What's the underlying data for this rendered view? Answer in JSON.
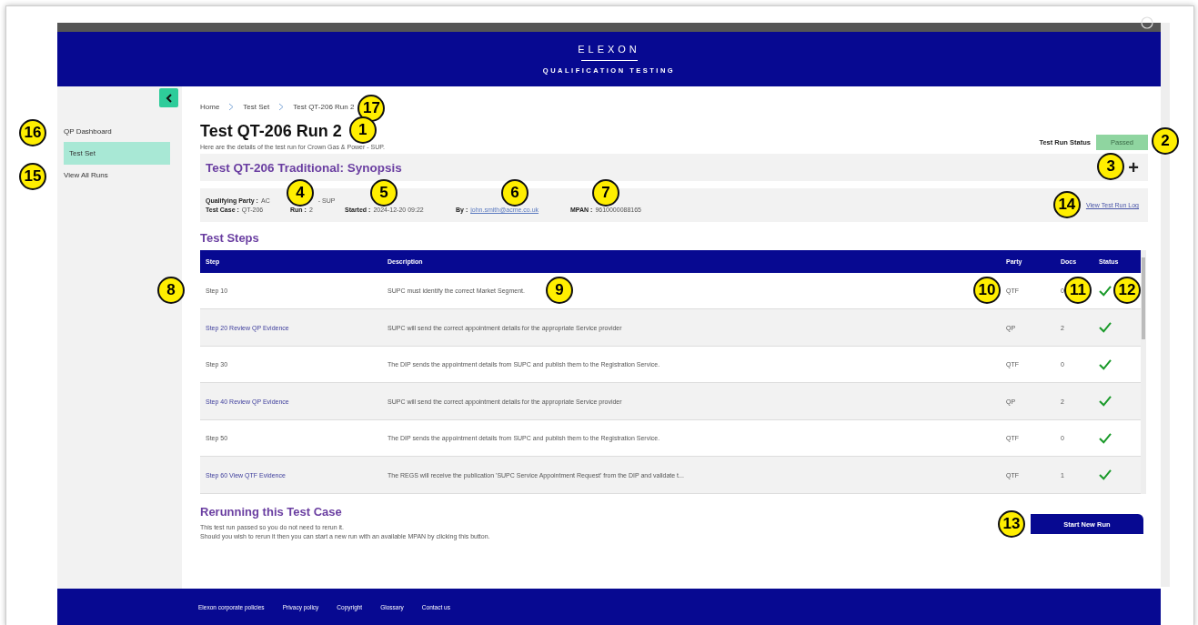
{
  "header": {
    "logo": "ELEXON",
    "subtitle": "QUALIFICATION TESTING"
  },
  "sidebar": {
    "items": [
      {
        "label": "QP Dashboard",
        "selected": false,
        "callout": "16"
      },
      {
        "label": "Test Set",
        "selected": true
      },
      {
        "label": "View All Runs",
        "selected": false,
        "callout": "15"
      }
    ]
  },
  "breadcrumb": {
    "items": [
      "Home",
      "Test Set",
      "Test QT-206 Run 2"
    ],
    "callout": "17"
  },
  "page": {
    "title": "Test QT-206 Run 2",
    "title_callout": "1",
    "description": "Here are the details of the test run for Crown Gas & Power - SUP.",
    "status_label": "Test Run Status",
    "status": "Passed",
    "status_callout": "2"
  },
  "synopsis": {
    "title": "Test QT-206 Traditional: Synopsis",
    "expand": "+",
    "callout": "3"
  },
  "details": {
    "qualifying_party": {
      "label": "Qualifying Party :",
      "value_start": "AC",
      "value_end": "- SUP"
    },
    "fields": [
      {
        "label": "Test Case :",
        "value": "QT-206",
        "kind": "text"
      },
      {
        "label": "Run :",
        "value": "2",
        "kind": "text",
        "callout": "4"
      },
      {
        "label": "Started :",
        "value": "2024-12-20 09:22",
        "kind": "text",
        "callout": "5"
      },
      {
        "label": "By :",
        "value": "john.smith@acme.co.uk",
        "kind": "link",
        "callout": "6"
      },
      {
        "label": "MPAN :",
        "value": "9610000088165",
        "kind": "text",
        "callout": "7"
      }
    ],
    "log_link": "View Test Run Log",
    "log_callout": "14"
  },
  "test_steps": {
    "title": "Test Steps",
    "columns": [
      "Step",
      "Description",
      "Party",
      "Docs",
      "Status"
    ],
    "rows": [
      {
        "step": "Step 10",
        "link": false,
        "description": "SUPC must identify the correct Market Segment.",
        "party": "QTF",
        "docs": "0",
        "passed": true,
        "callouts": {
          "step": "8",
          "description": "9",
          "party": "10",
          "docs": "11",
          "status": "12"
        }
      },
      {
        "step": "Step 20 Review QP Evidence",
        "link": true,
        "description": "SUPC will send the correct appointment details for the appropriate Service provider",
        "party": "QP",
        "docs": "2",
        "passed": true
      },
      {
        "step": "Step 30",
        "link": false,
        "description": "The DIP sends the appointment details from SUPC and publish them to the Registration Service.",
        "party": "QTF",
        "docs": "0",
        "passed": true
      },
      {
        "step": "Step 40 Review QP Evidence",
        "link": true,
        "description": "SUPC will send the correct appointment details for the appropriate Service provider",
        "party": "QP",
        "docs": "2",
        "passed": true
      },
      {
        "step": "Step 50",
        "link": false,
        "description": "The DIP sends the appointment details from SUPC and publish them to the Registration Service.",
        "party": "QTF",
        "docs": "0",
        "passed": true
      },
      {
        "step": "Step 60 View QTF Evidence",
        "link": true,
        "description": "The REGS will receive the publication 'SUPC Service Appointment Request' from the DIP and validate t...",
        "party": "QTF",
        "docs": "1",
        "passed": true
      }
    ]
  },
  "rerun": {
    "title": "Rerunning this Test Case",
    "lines": [
      "This test run passed so you do not need to rerun it.",
      "Should you wish to rerun it then you can start a new run with an available MPAN by clicking this button."
    ],
    "button": "Start New Run",
    "callout": "13"
  },
  "footer": {
    "links": [
      "Elexon corporate policies",
      "Privacy policy",
      "Copyright",
      "Glossary",
      "Contact us"
    ]
  }
}
